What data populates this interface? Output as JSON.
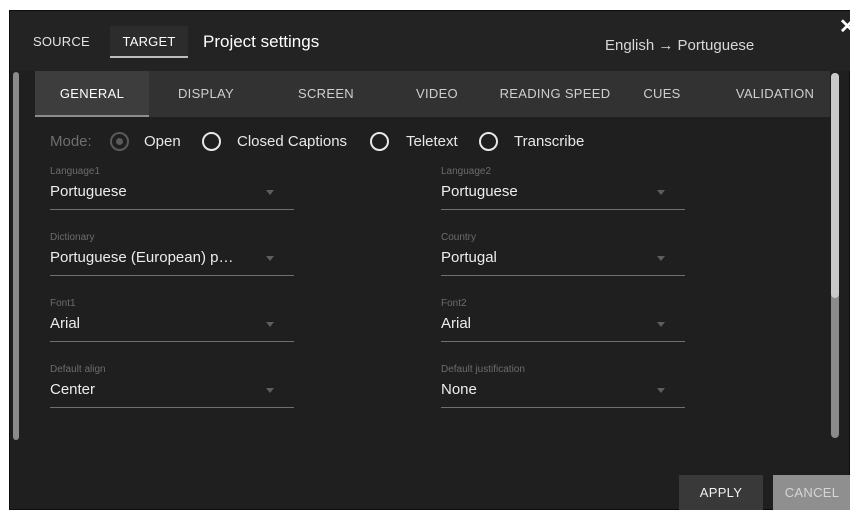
{
  "header": {
    "tabs": [
      {
        "label": "SOURCE",
        "active": false
      },
      {
        "label": "TARGET",
        "active": true
      }
    ],
    "title": "Project settings",
    "language_pair": "English → Portuguese",
    "close_icon": "close-icon"
  },
  "tabs": [
    {
      "label": "GENERAL",
      "active": true
    },
    {
      "label": "DISPLAY",
      "active": false
    },
    {
      "label": "SCREEN",
      "active": false
    },
    {
      "label": "VIDEO",
      "active": false
    },
    {
      "label": "READING SPEED",
      "active": false
    },
    {
      "label": "CUES",
      "active": false
    },
    {
      "label": "VALIDATION",
      "active": false
    }
  ],
  "mode": {
    "label": "Mode:",
    "options": [
      {
        "label": "Open",
        "checked": true,
        "disabled": true
      },
      {
        "label": "Closed Captions",
        "checked": false
      },
      {
        "label": "Teletext",
        "checked": false
      },
      {
        "label": "Transcribe",
        "checked": false
      }
    ]
  },
  "fields": {
    "language1": {
      "label": "Language1",
      "value": "Portuguese"
    },
    "language2": {
      "label": "Language2",
      "value": "Portuguese"
    },
    "dictionary": {
      "label": "Dictionary",
      "value": "Portuguese (European) p…"
    },
    "country": {
      "label": "Country",
      "value": "Portugal"
    },
    "font1": {
      "label": "Font1",
      "value": "Arial"
    },
    "font2": {
      "label": "Font2",
      "value": "Arial"
    },
    "default_align": {
      "label": "Default align",
      "value": "Center"
    },
    "default_justification": {
      "label": "Default justification",
      "value": "None"
    }
  },
  "buttons": {
    "apply": "APPLY",
    "cancel": "CANCEL"
  },
  "colors": {
    "background": "#1f1f1f",
    "tabbar": "#323232",
    "active_tab": "#3d3d3d",
    "text": "#ededed",
    "muted_label": "#6c6c6c"
  }
}
